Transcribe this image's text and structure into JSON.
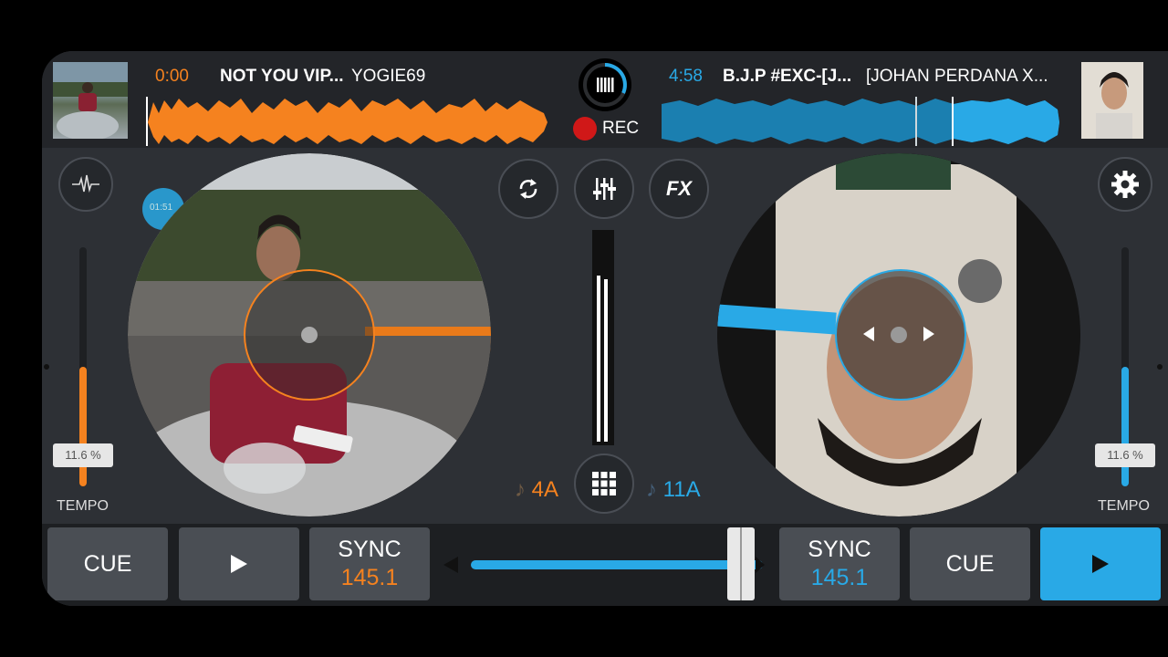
{
  "deck_left": {
    "time": "0:00",
    "title": "NOT YOU VIP...",
    "artist": "YOGIE69",
    "cue_position": "01:51",
    "tempo_pct": "11.6 %",
    "tempo_label": "TEMPO",
    "tempo_level": 0.42,
    "key": "4A",
    "sync_label": "SYNC",
    "bpm": "145.1",
    "cue_label": "CUE",
    "color": "#f5821f"
  },
  "deck_right": {
    "time": "4:58",
    "title": "B.J.P #EXC-[J...",
    "artist": "[JOHAN PERDANA X...",
    "tempo_pct": "11.6 %",
    "tempo_label": "TEMPO",
    "tempo_level": 0.42,
    "key": "11A",
    "sync_label": "SYNC",
    "bpm": "145.1",
    "cue_label": "CUE",
    "color": "#29a9e6"
  },
  "record": {
    "label": "REC"
  },
  "center_buttons": [
    "loop-sync-icon",
    "mixer-eq-icon",
    "FX"
  ],
  "fx_label": "FX",
  "crossfader_position": 0.92
}
